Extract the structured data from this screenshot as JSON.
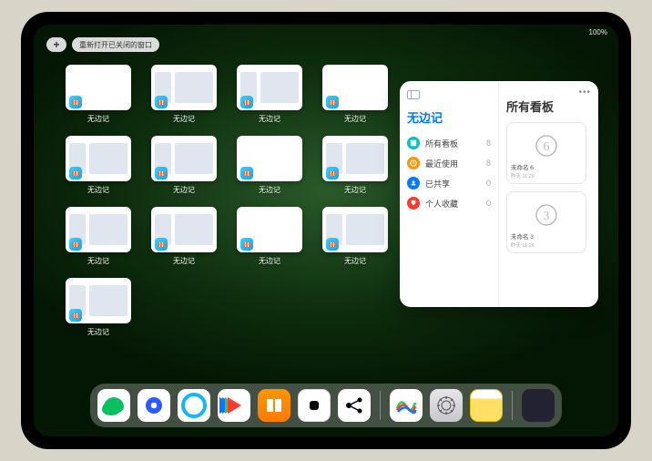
{
  "status": {
    "text": "100%"
  },
  "topbar": {
    "plus_label": "+",
    "reopen_label": "重新打开已关闭的窗口"
  },
  "app_switcher": {
    "app_name": "无边记",
    "thumbs": [
      {
        "variant": "blank"
      },
      {
        "variant": "calendar"
      },
      {
        "variant": "calendar"
      },
      {
        "variant": "blank"
      },
      {
        "variant": "calendar"
      },
      {
        "variant": "calendar"
      },
      {
        "variant": "blank"
      },
      {
        "variant": "calendar"
      },
      {
        "variant": "calendar"
      },
      {
        "variant": "calendar"
      },
      {
        "variant": "blank"
      },
      {
        "variant": "calendar"
      },
      {
        "variant": "calendar"
      }
    ]
  },
  "panel": {
    "left_title": "无边记",
    "rows": [
      {
        "icon_color": "#00c7be",
        "label": "所有看板",
        "count": 8
      },
      {
        "icon_color": "#ff9500",
        "label": "最近使用",
        "count": 8
      },
      {
        "icon_color": "#007aff",
        "label": "已共享",
        "count": 0
      },
      {
        "icon_color": "#ff3b30",
        "label": "个人收藏",
        "count": 0
      }
    ],
    "right_title": "所有看板",
    "boards": [
      {
        "glyph": "6",
        "name": "未命名 6",
        "time": "昨天 11:26"
      },
      {
        "glyph": "3",
        "name": "未命名 3",
        "time": "昨天 11:26"
      }
    ]
  },
  "dock": {
    "items": [
      {
        "id": "wechat",
        "name": "微信"
      },
      {
        "id": "qqb",
        "name": "QQ浏览器"
      },
      {
        "id": "qq",
        "name": "QQ"
      },
      {
        "id": "play",
        "name": "媒体"
      },
      {
        "id": "books",
        "name": "图书"
      },
      {
        "id": "dice",
        "name": "游戏"
      },
      {
        "id": "nodes",
        "name": "节点"
      },
      {
        "id": "freeform",
        "name": "无边记"
      },
      {
        "id": "settings",
        "name": "设置"
      },
      {
        "id": "notes",
        "name": "备忘录"
      },
      {
        "id": "library",
        "name": "App资源库"
      }
    ]
  }
}
